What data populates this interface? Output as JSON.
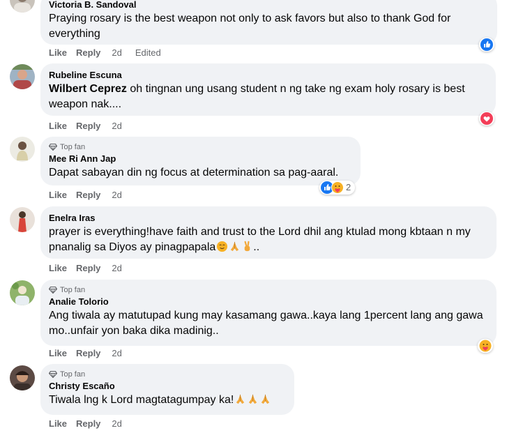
{
  "comments": [
    {
      "author": "Victoria B. Sandoval",
      "text": "Praying rosary is the best weapon not only to ask favors but also to thank God for everything",
      "actions": {
        "like": "Like",
        "reply": "Reply",
        "time": "2d",
        "edited": "Edited"
      },
      "reaction": {
        "icons": [
          "like-reaction-icon"
        ]
      }
    },
    {
      "author": "Rubeline Escuna",
      "mention": "Wilbert Ceprez",
      "text": "oh tingnan ung usang student n ng take ng exam holy rosary is best weapon nak....",
      "actions": {
        "like": "Like",
        "reply": "Reply",
        "time": "2d"
      },
      "reaction": {
        "icons": [
          "love-reaction-icon"
        ]
      }
    },
    {
      "badge": "Top fan",
      "author": "Mee Ri Ann Jap",
      "text": "Dapat sabayan din ng focus at determination sa pag-aaral.",
      "actions": {
        "like": "Like",
        "reply": "Reply",
        "time": "2d"
      },
      "reaction": {
        "icons": [
          "like-reaction-icon",
          "care-reaction-icon"
        ],
        "count": "2"
      }
    },
    {
      "author": "Enelra Iras",
      "text": "prayer is everything!have faith and trust to the Lord dhil ang ktulad mong kbtaan n my pnanalig sa Diyos ay pinagpapala",
      "text_suffix": "..",
      "actions": {
        "like": "Like",
        "reply": "Reply",
        "time": "2d"
      }
    },
    {
      "badge": "Top fan",
      "author": "Analie Tolorio",
      "text": "Ang tiwala ay matutupad kung may kasamang gawa..kaya lang 1percent lang ang gawa mo..unfair yon baka dika madinig..",
      "actions": {
        "like": "Like",
        "reply": "Reply",
        "time": "2d"
      },
      "reaction": {
        "icons": [
          "care-reaction-icon"
        ]
      }
    },
    {
      "badge": "Top fan",
      "author": "Christy Escaño",
      "text": "Tiwala lng k Lord magtatagumpay ka!",
      "actions": {
        "like": "Like",
        "reply": "Reply",
        "time": "2d"
      }
    }
  ],
  "colors": {
    "bubble": "#f0f2f5",
    "secondary_text": "#65676b",
    "like_blue": "#1877f2",
    "love_red": "#f33e58",
    "care_yellow": "#f7b125"
  }
}
